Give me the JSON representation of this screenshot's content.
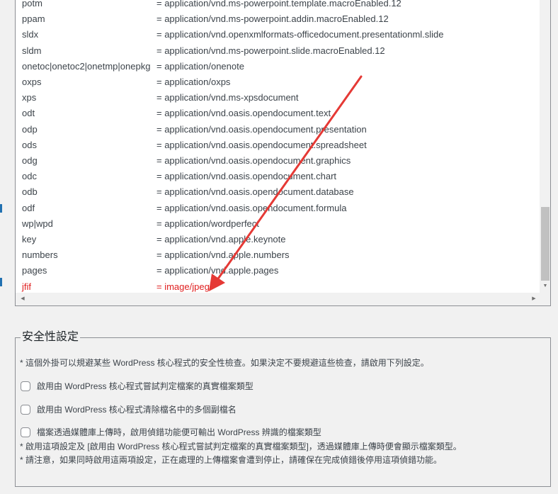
{
  "mime_list": [
    {
      "ext": "potm",
      "mime": "= application/vnd.ms-powerpoint.template.macroEnabled.12"
    },
    {
      "ext": "ppam",
      "mime": "= application/vnd.ms-powerpoint.addin.macroEnabled.12"
    },
    {
      "ext": "sldx",
      "mime": "= application/vnd.openxmlformats-officedocument.presentationml.slide"
    },
    {
      "ext": "sldm",
      "mime": "= application/vnd.ms-powerpoint.slide.macroEnabled.12"
    },
    {
      "ext": "onetoc|onetoc2|onetmp|onepkg",
      "mime": "= application/onenote"
    },
    {
      "ext": "oxps",
      "mime": "= application/oxps"
    },
    {
      "ext": "xps",
      "mime": "= application/vnd.ms-xpsdocument"
    },
    {
      "ext": "odt",
      "mime": "= application/vnd.oasis.opendocument.text"
    },
    {
      "ext": "odp",
      "mime": "= application/vnd.oasis.opendocument.presentation"
    },
    {
      "ext": "ods",
      "mime": "= application/vnd.oasis.opendocument.spreadsheet"
    },
    {
      "ext": "odg",
      "mime": "= application/vnd.oasis.opendocument.graphics"
    },
    {
      "ext": "odc",
      "mime": "= application/vnd.oasis.opendocument.chart"
    },
    {
      "ext": "odb",
      "mime": "= application/vnd.oasis.opendocument.database"
    },
    {
      "ext": "odf",
      "mime": "= application/vnd.oasis.opendocument.formula"
    },
    {
      "ext": "wp|wpd",
      "mime": "= application/wordperfect"
    },
    {
      "ext": "key",
      "mime": "= application/vnd.apple.keynote"
    },
    {
      "ext": "numbers",
      "mime": "= application/vnd.apple.numbers"
    },
    {
      "ext": "pages",
      "mime": "= application/vnd.apple.pages"
    },
    {
      "ext": "jfif",
      "mime": "= image/jpeg",
      "highlight": true
    }
  ],
  "scrollbar": {
    "up_icon": "triangle-up-icon",
    "down_icon": "triangle-down-icon",
    "left_icon": "triangle-left-icon",
    "right_icon": "triangle-right-icon",
    "down_glyph": "▼",
    "left_glyph": "◀",
    "right_glyph": "▶"
  },
  "annotation": {
    "color": "#e53935",
    "icon": "red-arrow-icon"
  },
  "security": {
    "legend": "安全性設定",
    "note": "* 這個外掛可以規避某些 WordPress 核心程式的安全性檢查。如果決定不要規避這些檢查，請啟用下列設定。",
    "options": [
      {
        "label": "啟用由 WordPress 核心程式嘗試判定檔案的真實檔案類型",
        "checked": false
      },
      {
        "label": "啟用由 WordPress 核心程式清除檔名中的多個副檔名",
        "checked": false
      },
      {
        "label": "檔案透過媒體庫上傳時，啟用偵錯功能便可輸出 WordPress 辨識的檔案類型",
        "checked": false
      }
    ],
    "debug_notes": [
      "* 啟用這項設定及 [啟用由 WordPress 核心程式嘗試判定檔案的真實檔案類型]，透過媒體庫上傳時便會顯示檔案類型。",
      "* 請注意，如果同時啟用這兩項設定，正在處理的上傳檔案會遭到停止，請確保在完成偵錯後停用這項偵錯功能。"
    ]
  },
  "colors": {
    "highlight": "#e02020",
    "border": "#8c8f94",
    "sidebar_accent": "#2271b1"
  }
}
